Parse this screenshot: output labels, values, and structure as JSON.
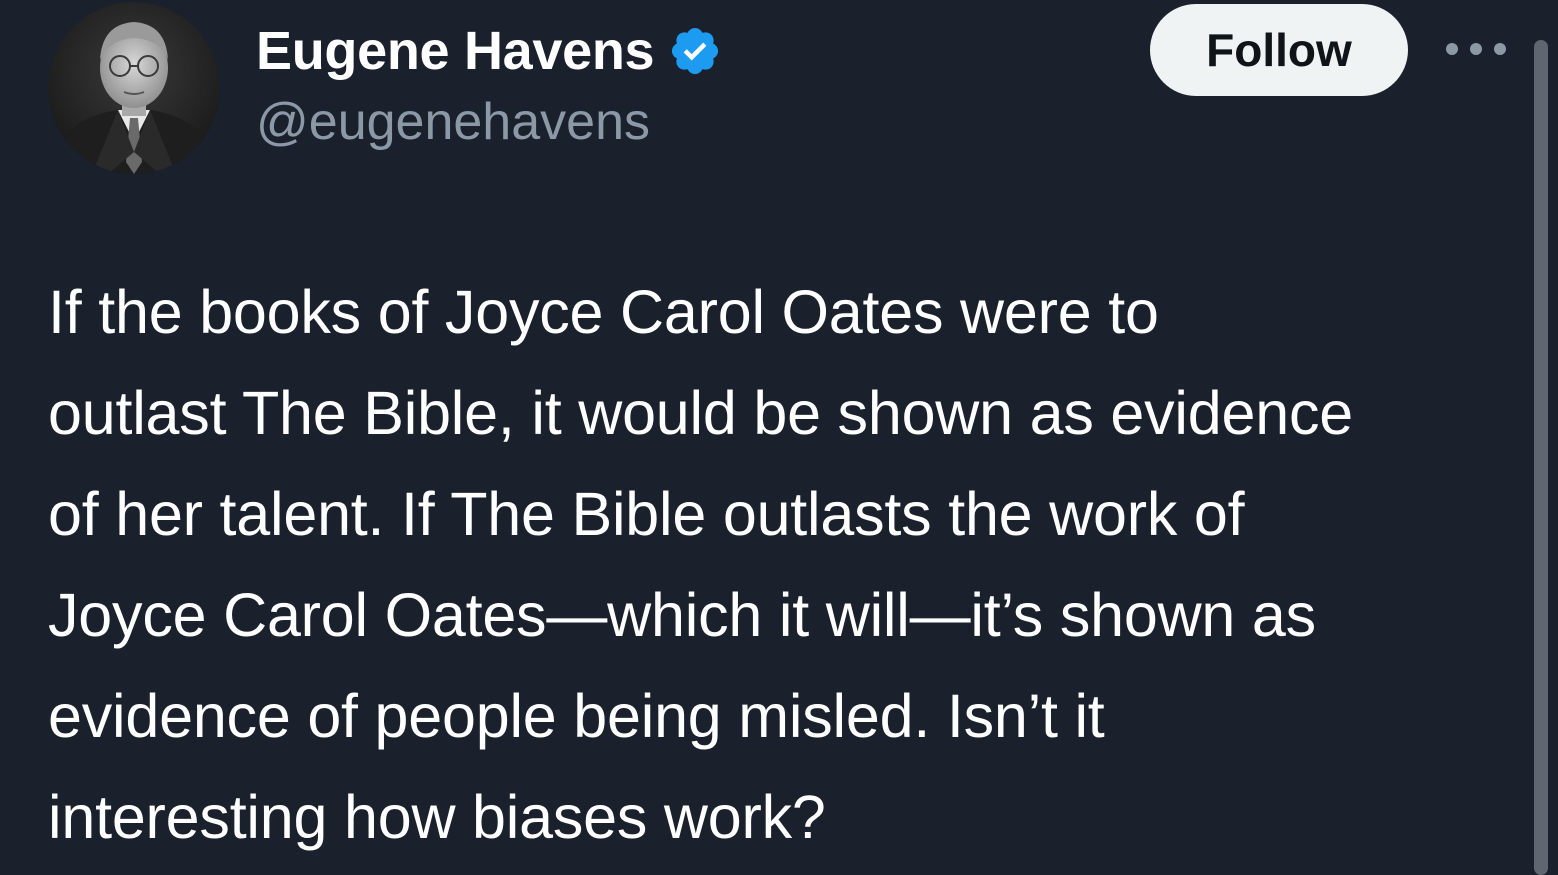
{
  "author": {
    "display_name": "Eugene Havens",
    "handle": "@eugenehavens",
    "verified": true,
    "avatar_icon": "profile-photo",
    "verified_icon": "verified-badge-icon"
  },
  "actions": {
    "follow_label": "Follow",
    "more_icon": "more-options-icon"
  },
  "tweet": {
    "lines": [
      "If the books of Joyce Carol Oates were to",
      "outlast The Bible, it would be shown as evidence",
      "of her talent. If The Bible outlasts the work of",
      "Joyce Carol Oates—which it will—it’s shown as",
      "evidence of people being misled. Isn’t it",
      "interesting how biases work?"
    ]
  },
  "colors": {
    "background": "#1b212c",
    "text_primary": "#ffffff",
    "text_secondary": "#8b98a5",
    "verified_blue": "#1d9bf0",
    "follow_bg": "#eff3f4",
    "follow_text": "#0f1419"
  }
}
